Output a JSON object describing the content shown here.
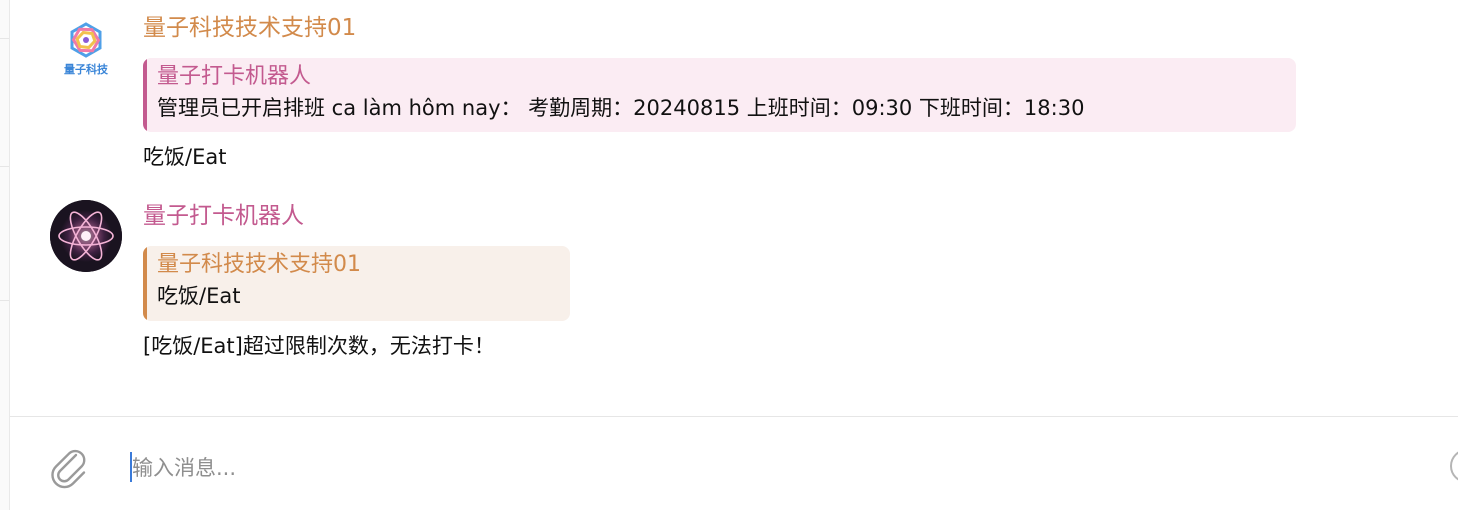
{
  "messages": [
    {
      "sender": "量子科技技术支持01",
      "avatar": {
        "icon": "quantum-tech-logo",
        "label": "量子科技"
      },
      "quote": {
        "author": "量子打卡机器人",
        "text": "管理员已开启排班  ca làm hôm nay：  考勤周期：20240815 上班时间：09:30 下班时间：18:30"
      },
      "text": "吃饭/Eat"
    },
    {
      "sender": "量子打卡机器人",
      "avatar": {
        "icon": "atom-avatar-icon"
      },
      "quote": {
        "author": "量子科技技术支持01",
        "text": "吃饭/Eat"
      },
      "text": "[吃饭/Eat]超过限制次数，无法打卡！"
    }
  ],
  "composer": {
    "placeholder": "输入消息...",
    "attach_icon": "paperclip-icon"
  },
  "colors": {
    "orange_accent": "#d28a4b",
    "pink_accent": "#c35a8f",
    "pink_quote_bg": "#fbecf3",
    "orange_quote_bg": "#f8f0ea"
  }
}
